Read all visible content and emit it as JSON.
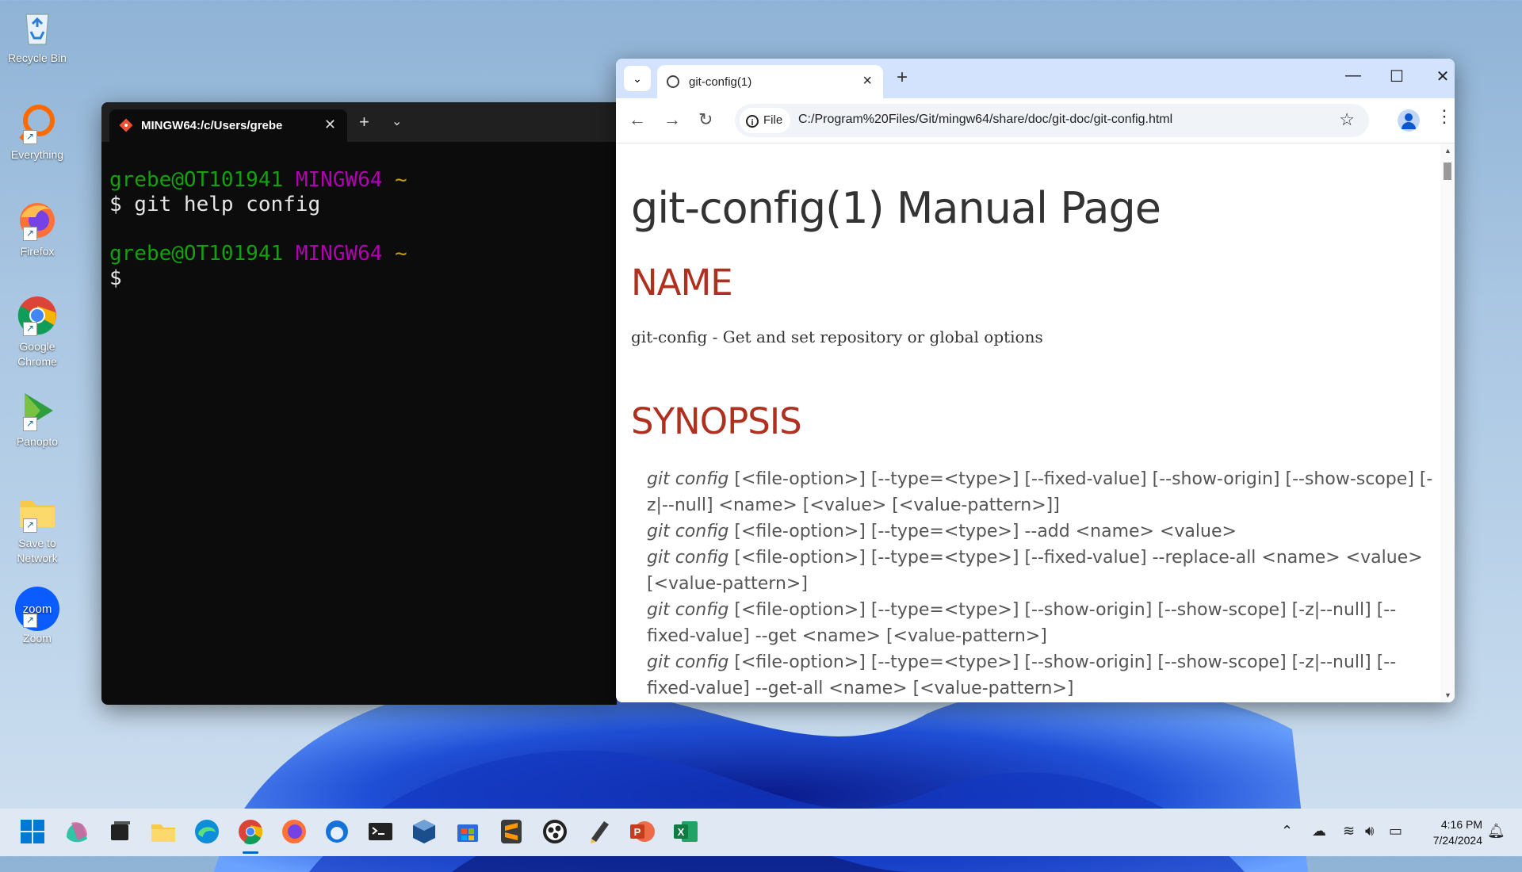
{
  "desktop": {
    "icons": [
      {
        "label": "Recycle Bin"
      },
      {
        "label": "Everything"
      },
      {
        "label": "Firefox"
      },
      {
        "label": "Google Chrome"
      },
      {
        "label": "Panopto"
      },
      {
        "label": "Save to Network"
      },
      {
        "label": "Zoom"
      }
    ]
  },
  "terminal": {
    "tab_title": "MINGW64:/c/Users/grebe",
    "plus": "+",
    "dropdown": "⌄",
    "close": "✕",
    "lines": [
      {
        "user": "grebe@OT101941",
        "env": "MINGW64",
        "dir": "~"
      },
      {
        "prompt": "$ git help config"
      },
      {
        "user": "grebe@OT101941",
        "env": "MINGW64",
        "dir": "~"
      },
      {
        "prompt": "$"
      }
    ]
  },
  "browser": {
    "tab_title": "git-config(1)",
    "new_tab": "+",
    "file_chip": "File",
    "url": "C:/Program%20Files/Git/mingw64/share/doc/git-doc/git-config.html",
    "page": {
      "title": "git-config(1) Manual Page",
      "name_heading": "NAME",
      "name_text": "git-config - Get and set repository or global options",
      "synopsis_heading": "SYNOPSIS",
      "synopsis_cmd": "git config",
      "synopsis": [
        " [<file-option>] [--type=<type>] [--fixed-value] [--show-origin] [--show-scope] [-z|--null] <name> [<value> [<value-pattern>]]",
        " [<file-option>] [--type=<type>] --add <name> <value>",
        " [<file-option>] [--type=<type>] [--fixed-value] --replace-all <name> <value> [<value-pattern>]",
        " [<file-option>] [--type=<type>] [--show-origin] [--show-scope] [-z|--null] [--fixed-value] --get <name> [<value-pattern>]",
        " [<file-option>] [--type=<type>] [--show-origin] [--show-scope] [-z|--null] [--fixed-value] --get-all <name> [<value-pattern>]"
      ]
    }
  },
  "taskbar": {
    "time": "4:16 PM",
    "date": "7/24/2024"
  }
}
